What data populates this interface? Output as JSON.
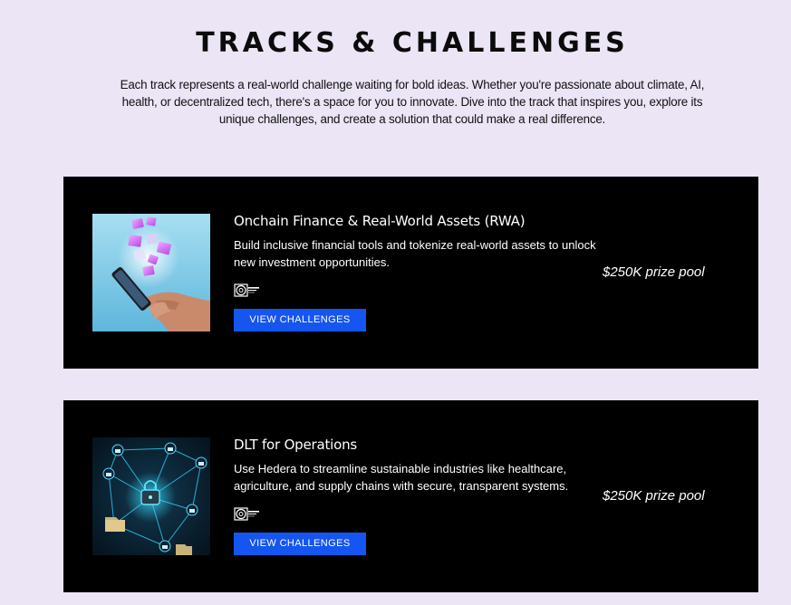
{
  "header": {
    "title": "TRACKS & CHALLENGES",
    "intro": "Each track represents a real-world challenge waiting for bold ideas. Whether you're passionate about climate, AI, health, or decentralized tech, there's a space for you to innovate. Dive into the track that inspires you, explore its unique challenges, and create a solution that could make a real difference."
  },
  "tracks": [
    {
      "title": "Onchain Finance & Real-World Assets (RWA)",
      "description": "Build inclusive financial tools and tokenize real-world assets to unlock new investment opportunities.",
      "button_label": "VIEW CHALLENGES",
      "prize": "$250K prize pool",
      "image_icon": "phone-with-floating-cubes",
      "sponsor_icon": "sponsor-logo"
    },
    {
      "title": "DLT for Operations",
      "description": "Use Hedera to streamline sustainable industries like healthcare, agriculture, and supply chains with secure, transparent systems.",
      "button_label": "VIEW CHALLENGES",
      "prize": "$250K prize pool",
      "image_icon": "network-lock",
      "sponsor_icon": "sponsor-logo"
    }
  ],
  "colors": {
    "page_background": "#ebe5f6",
    "card_background": "#000000",
    "button": "#1556f0",
    "text_light": "#ffffff"
  }
}
